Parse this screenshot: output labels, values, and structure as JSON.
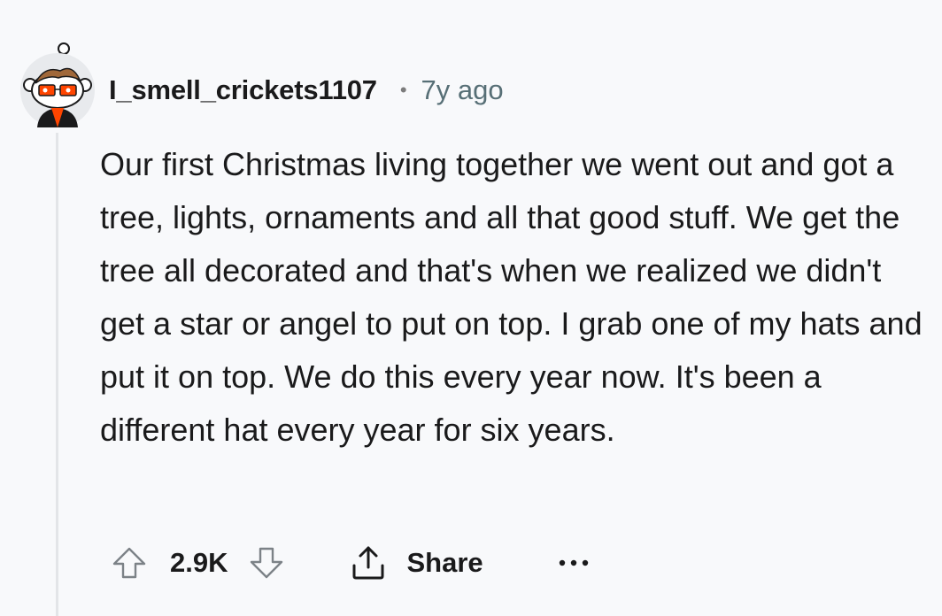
{
  "comment": {
    "username": "I_smell_crickets1107",
    "separator": "•",
    "timestamp": "7y ago",
    "body": "Our first Christmas living together we went out and got a tree, lights, ornaments and all that good stuff. We get the tree all decorated and that's when we realized we didn't get a star or angel to put on top. I grab one of my hats and put it on top. We do this every year now. It's been a different hat every year for six years."
  },
  "actions": {
    "score": "2.9K",
    "share_label": "Share"
  },
  "icons": {
    "upvote": "arrow-up-outline-icon",
    "downvote": "arrow-down-outline-icon",
    "share": "share-upload-icon",
    "more": "ellipsis-horizontal-icon"
  },
  "colors": {
    "background": "#f8f9fb",
    "text": "#1a1a1b",
    "meta": "#576f76",
    "thread_line": "#e3e5e8",
    "avatar_accent": "#ff4500"
  }
}
